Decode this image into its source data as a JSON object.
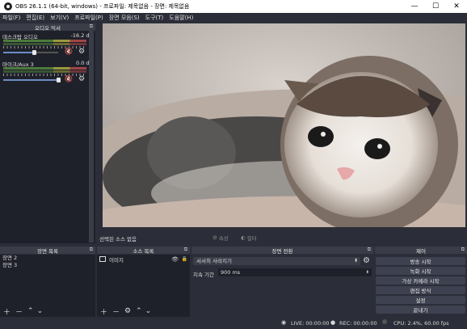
{
  "window": {
    "title": "OBS 26.1.1 (64-bit, windows) - 프로파일: 제목없음 - 장면: 제목없음",
    "min": "—",
    "max": "☐",
    "close": "✕"
  },
  "menu": [
    "파일(F)",
    "편집(E)",
    "보기(V)",
    "프로파일(P)",
    "장면 모음(S)",
    "도구(T)",
    "도움말(H)"
  ],
  "mixer": {
    "title": "오디오 믹서",
    "channels": [
      {
        "name": "데스크탑 오디오",
        "db": "-16.2 dB",
        "volume": 0.7
      },
      {
        "name": "마이크/Aux 3",
        "db": "0.0 dB",
        "volume": 1.0
      }
    ]
  },
  "source_toolbar": {
    "no_source": "선택된 소스 없음",
    "properties": "속성",
    "filters": "필터"
  },
  "scenes": {
    "title": "장면 목록",
    "items": [
      "장면 2",
      "장면 3"
    ]
  },
  "sources": {
    "title": "소스 목록",
    "items": [
      {
        "name": "이미지"
      }
    ]
  },
  "transitions": {
    "title": "장면 전환",
    "selected": "서서히 사라지기",
    "duration_label": "지속 기간",
    "duration": "900 ms"
  },
  "controls": {
    "title": "제어",
    "buttons": [
      "방송 시작",
      "녹화 시작",
      "가상 카메라 시작",
      "편집 방식",
      "설정",
      "끝내기"
    ]
  },
  "status": {
    "live": "LIVE: 00:00:00",
    "rec": "REC: 00:00:00",
    "cpu": "CPU: 2.4%, 60.00 fps"
  },
  "icons": {
    "gear": "gear-icon",
    "speaker_muted": "speaker-muted-icon",
    "eye": "eye-icon",
    "lock": "lock-icon"
  }
}
